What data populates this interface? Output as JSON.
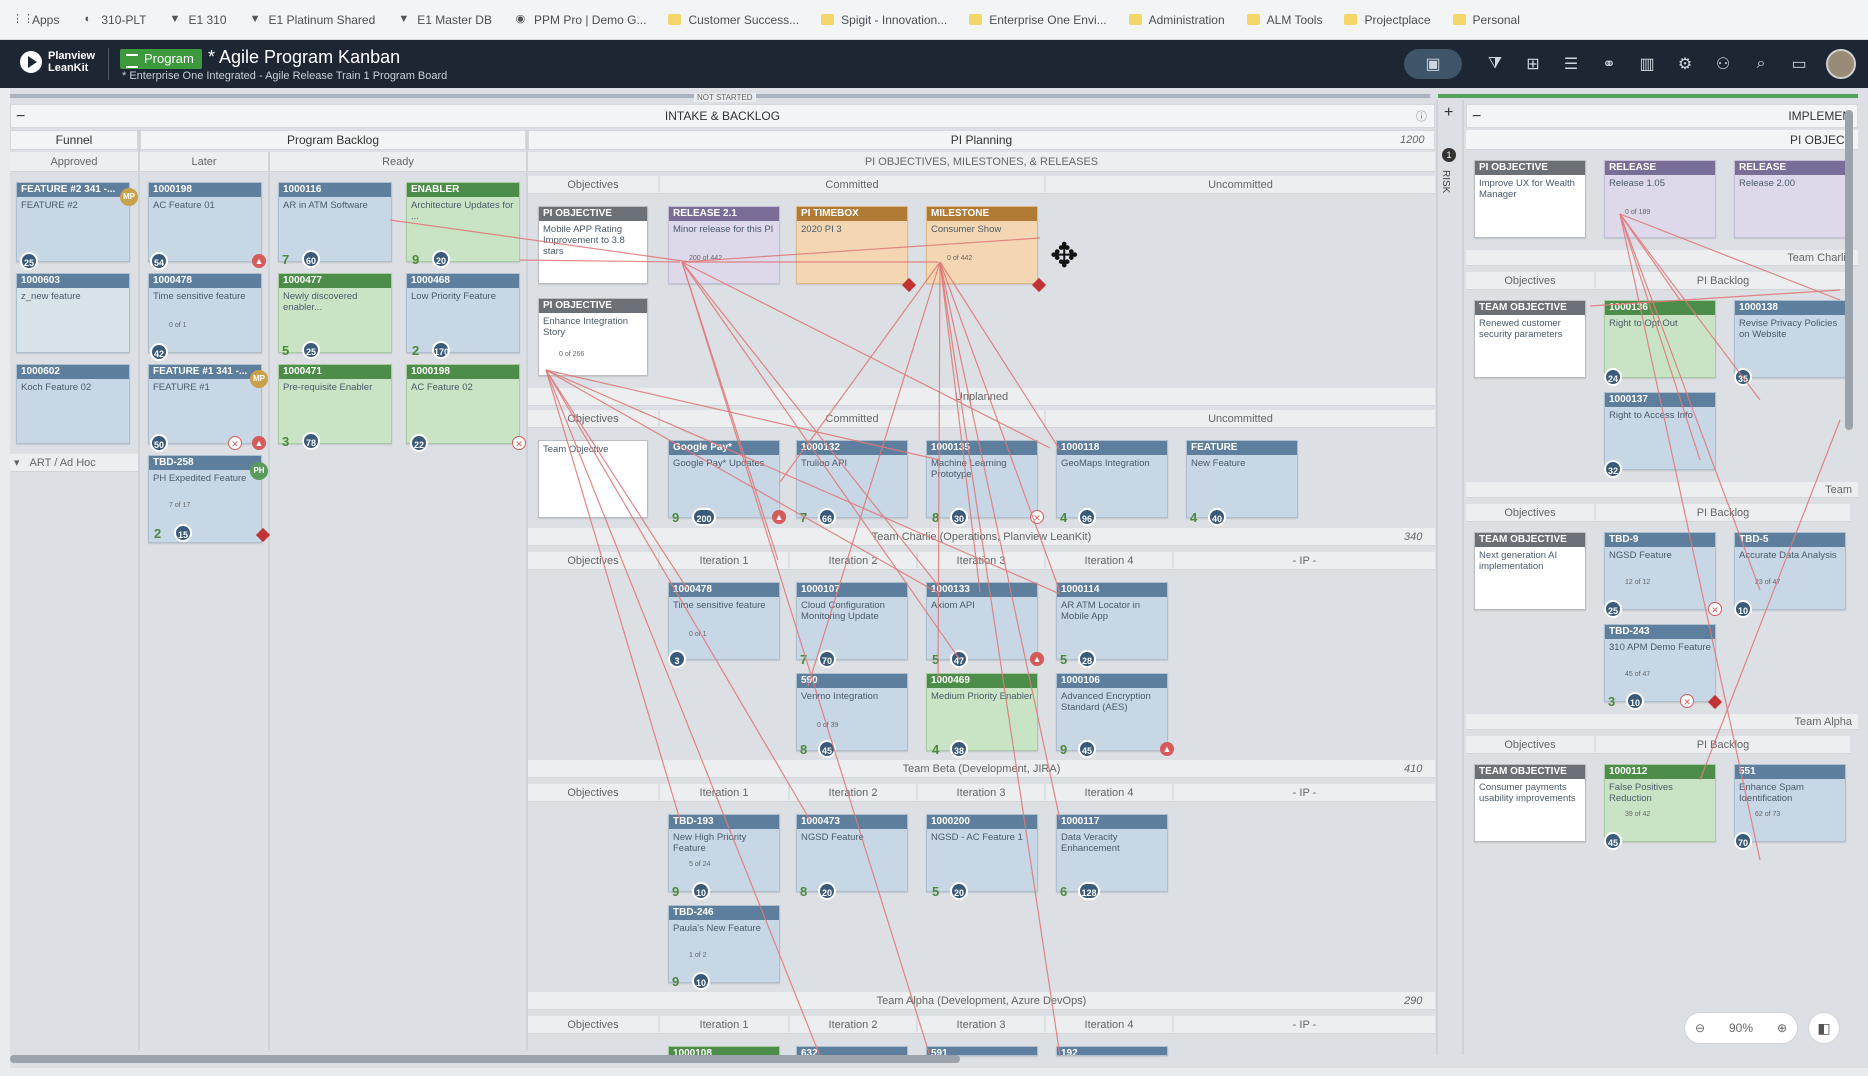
{
  "bookmarks": [
    "Apps",
    "310-PLT",
    "E1 310",
    "E1 Platinum Shared",
    "E1 Master DB",
    "PPM Pro | Demo G...",
    "Customer Success...",
    "Spigit - Innovation...",
    "Enterprise One Envi...",
    "Administration",
    "ALM Tools",
    "Projectplace",
    "Personal"
  ],
  "header": {
    "logo_line1": "Planview",
    "logo_line2": "LeanKit",
    "badge": "Program",
    "title": "* Agile Program Kanban",
    "subtitle": "* Enterprise One Integrated - Agile Release Train 1 Program Board"
  },
  "board": {
    "not_started": "NOT STARTED",
    "intake_title": "INTAKE & BACKLOG",
    "implement_title": "IMPLEMEN",
    "funnel": "Funnel",
    "approved": "Approved",
    "program_backlog": "Program Backlog",
    "later": "Later",
    "ready": "Ready",
    "pi_planning": "PI Planning",
    "pi_count": "1200",
    "pi_objectives_ms": "PI OBJECTIVES, MILESTONES, & RELEASES",
    "objectives": "Objectives",
    "committed": "Committed",
    "uncommitted": "Uncommitted",
    "unplanned": "Unplanned",
    "art_adhoc": "ART / Ad Hoc",
    "team_charlie": "Team Charlie (Operations, Planview LeanKit)",
    "team_charlie_count": "340",
    "team_beta": "Team Beta (Development, JIRA)",
    "team_beta_count": "410",
    "team_alpha": "Team Alpha (Development, Azure DevOps)",
    "team_alpha_count": "290",
    "iter1": "Iteration 1",
    "iter2": "Iteration 2",
    "iter3": "Iteration 3",
    "iter4": "Iteration 4",
    "ip": "- IP -",
    "risk": "RISK",
    "risk_count": "1",
    "pi_object_right": "PI OBJECT",
    "team_charlie_short": "Team Charlie",
    "team_short": "Team",
    "team_alpha_short": "Team Alpha",
    "pi_backlog": "PI Backlog"
  },
  "cards": {
    "f1": {
      "id": "FEATURE #2 341 -...",
      "text": "FEATURE #2",
      "badge": "25"
    },
    "f2": {
      "id": "1000603",
      "text": "z_new feature"
    },
    "f3": {
      "id": "1000602",
      "text": "Koch Feature 02"
    },
    "l1": {
      "id": "1000198",
      "text": "AC Feature 01",
      "badge": "54"
    },
    "l2": {
      "id": "1000478",
      "text": "Time sensitive feature",
      "badge": "42",
      "prog": "0 of 1"
    },
    "l3": {
      "id": "FEATURE #1 341 -...",
      "text": "FEATURE #1",
      "badge": "50"
    },
    "l4": {
      "id": "TBD-258",
      "text": "PH Expedited Feature",
      "num": "2",
      "badge": "15",
      "prog": "7 of 17"
    },
    "r1": {
      "id": "1000116",
      "text": "AR in ATM Software",
      "num": "7",
      "badge": "60"
    },
    "r2": {
      "id": "1000477",
      "text": "Newly discovered enabler...",
      "num": "5",
      "badge": "25"
    },
    "r3": {
      "id": "1000471",
      "text": "Pre-requisite Enabler",
      "num": "3",
      "badge": "78"
    },
    "e1": {
      "id": "ENABLER",
      "text": "Architecture Updates for ...",
      "num": "9",
      "badge": "20"
    },
    "e2": {
      "id": "1000468",
      "text": "Low Priority Feature",
      "num": "2",
      "badge": "170"
    },
    "e3": {
      "id": "1000198",
      "text": "AC Feature 02",
      "badge": "22"
    },
    "o1": {
      "id": "PI OBJECTIVE",
      "text": "Mobile APP Rating Improvement to 3.8 stars"
    },
    "o2": {
      "id": "PI OBJECTIVE",
      "text": "Enhance Integration Story",
      "prog": "0 of 266"
    },
    "c1": {
      "id": "RELEASE 2.1",
      "text": "Minor release for this PI",
      "prog": "200 of 442"
    },
    "c2": {
      "id": "PI TIMEBOX",
      "text": "2020 PI 3"
    },
    "c3": {
      "id": "MILESTONE",
      "text": "Consumer Show",
      "prog": "0 of 442"
    },
    "to1": {
      "text": "Team Objective"
    },
    "u1": {
      "id": "Google Pay*",
      "text": "Google Pay* Updates",
      "num": "9",
      "badge": "200"
    },
    "u2": {
      "id": "1000132",
      "text": "Trulioo API",
      "num": "7",
      "badge": "66"
    },
    "u3": {
      "id": "1000135",
      "text": "Machine Learning Prototype",
      "num": "8",
      "badge": "30"
    },
    "u4": {
      "id": "1000118",
      "text": "GeoMaps Integration",
      "num": "4",
      "badge": "96"
    },
    "u5": {
      "id": "FEATURE",
      "text": "New Feature",
      "num": "4",
      "badge": "40"
    },
    "t1": {
      "id": "1000478",
      "text": "Time sensitive feature",
      "badge": "3",
      "prog": "0 of 1"
    },
    "t2": {
      "id": "1000107",
      "text": "Cloud Configuration Monitoring Update",
      "num": "7",
      "badge": "70"
    },
    "t3": {
      "id": "1000133",
      "text": "Axiom API",
      "num": "5",
      "badge": "47"
    },
    "t4": {
      "id": "1000114",
      "text": "AR ATM Locator in Mobile App",
      "num": "5",
      "badge": "28"
    },
    "t5": {
      "id": "590",
      "text": "Venmo Integration",
      "num": "8",
      "badge": "45",
      "prog": "0 of 39"
    },
    "t6": {
      "id": "1000469",
      "text": "Medium Priority Enabler",
      "num": "4",
      "badge": "38"
    },
    "t7": {
      "id": "1000106",
      "text": "Advanced Encryption Standard (AES)",
      "num": "9",
      "badge": "45"
    },
    "b1": {
      "id": "TBD-193",
      "text": "New High Priority Feature",
      "num": "9",
      "badge": "10",
      "prog": "5 of 24"
    },
    "b2": {
      "id": "1000473",
      "text": "NGSD Feature",
      "num": "8",
      "badge": "20"
    },
    "b3": {
      "id": "1000200",
      "text": "NGSD - AC Feature 1",
      "num": "5",
      "badge": "20"
    },
    "b4": {
      "id": "1000117",
      "text": "Data Veracity Enhancement",
      "num": "6",
      "badge": "128"
    },
    "b5": {
      "id": "TBD-246",
      "text": "Paula's New Feature",
      "num": "9",
      "badge": "10",
      "prog": "1 of 2"
    },
    "a1": {
      "id": "1000108"
    },
    "a2": {
      "id": "632"
    },
    "a3": {
      "id": "591"
    },
    "a4": {
      "id": "192"
    },
    "ro1": {
      "id": "PI OBJECTIVE",
      "text": "Improve UX for Wealth Manager"
    },
    "rr1": {
      "id": "RELEASE",
      "text": "Release 1.05",
      "prog": "0 of 189"
    },
    "rr2": {
      "id": "RELEASE",
      "text": "Release 2.00"
    },
    "rt1": {
      "id": "TEAM OBJECTIVE",
      "text": "Renewed customer security parameters"
    },
    "rb1": {
      "id": "1000136",
      "text": "Right to Opt Out",
      "badge": "24"
    },
    "rb2": {
      "id": "1000138",
      "text": "Revise Privacy Policies on Website",
      "badge": "35"
    },
    "rb3": {
      "id": "1000137",
      "text": "Right to Access Info",
      "badge": "32"
    },
    "rt2": {
      "id": "TEAM OBJECTIVE",
      "text": "Next generation AI implementation"
    },
    "rb4": {
      "id": "TBD-9",
      "text": "NGSD Feature",
      "badge": "25",
      "prog": "12 of 12"
    },
    "rb5": {
      "id": "TBD-5",
      "text": "Accurate Data Analysis",
      "badge": "10",
      "prog": "23 of 47"
    },
    "rb6": {
      "id": "TBD-243",
      "text": "310 APM Demo Feature",
      "num": "3",
      "badge": "10",
      "prog": "45 of 47"
    },
    "rt3": {
      "id": "TEAM OBJECTIVE",
      "text": "Consumer payments usability improvements"
    },
    "rb7": {
      "id": "1000112",
      "text": "False Positives Reduction",
      "badge": "45",
      "prog": "39 of 42"
    },
    "rb8": {
      "id": "551",
      "text": "Enhance Spam Identification",
      "badge": "70",
      "prog": "62 of 73"
    }
  },
  "zoom": {
    "level": "90%"
  },
  "colors": {
    "header_bg": "#1d2733",
    "program_badge": "#3c9a3c",
    "card_blue": "#c7d7e6",
    "card_green": "#c9e4c4",
    "link_line": "#e07a7a"
  }
}
